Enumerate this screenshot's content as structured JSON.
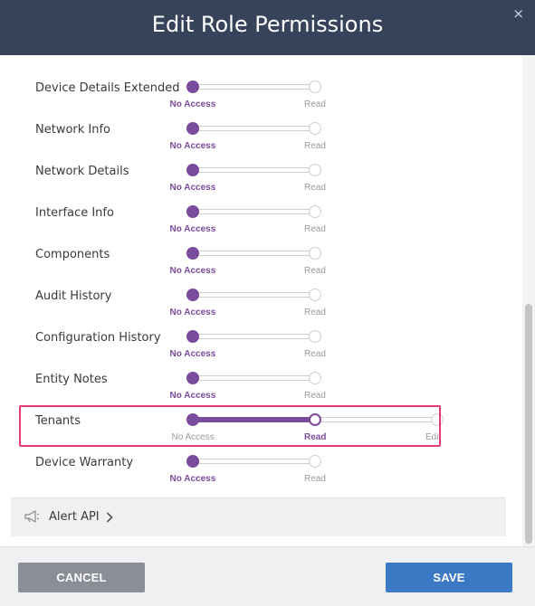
{
  "dialog": {
    "title": "Edit Role Permissions",
    "close_glyph": "×"
  },
  "permission_levels": [
    "No Access",
    "Read",
    "Edit"
  ],
  "permissions": [
    {
      "label": "Device Details Extended",
      "levels": [
        "No Access",
        "Read"
      ],
      "selected": "No Access"
    },
    {
      "label": "Network Info",
      "levels": [
        "No Access",
        "Read"
      ],
      "selected": "No Access"
    },
    {
      "label": "Network Details",
      "levels": [
        "No Access",
        "Read"
      ],
      "selected": "No Access"
    },
    {
      "label": "Interface Info",
      "levels": [
        "No Access",
        "Read"
      ],
      "selected": "No Access"
    },
    {
      "label": "Components",
      "levels": [
        "No Access",
        "Read"
      ],
      "selected": "No Access"
    },
    {
      "label": "Audit History",
      "levels": [
        "No Access",
        "Read"
      ],
      "selected": "No Access"
    },
    {
      "label": "Configuration History",
      "levels": [
        "No Access",
        "Read"
      ],
      "selected": "No Access"
    },
    {
      "label": "Entity Notes",
      "levels": [
        "No Access",
        "Read"
      ],
      "selected": "No Access"
    },
    {
      "label": "Tenants",
      "levels": [
        "No Access",
        "Read",
        "Edit"
      ],
      "selected": "Read",
      "highlighted": true
    },
    {
      "label": "Device Warranty",
      "levels": [
        "No Access",
        "Read"
      ],
      "selected": "No Access"
    }
  ],
  "alert_section": {
    "label": "Alert API",
    "icon": "megaphone-icon"
  },
  "footer": {
    "cancel_label": "CANCEL",
    "save_label": "SAVE"
  },
  "colors": {
    "header_bg": "#36435b",
    "accent": "#7b4b9c",
    "highlight": "#e33c79",
    "save": "#3b79c5",
    "cancel": "#8b8e97"
  }
}
